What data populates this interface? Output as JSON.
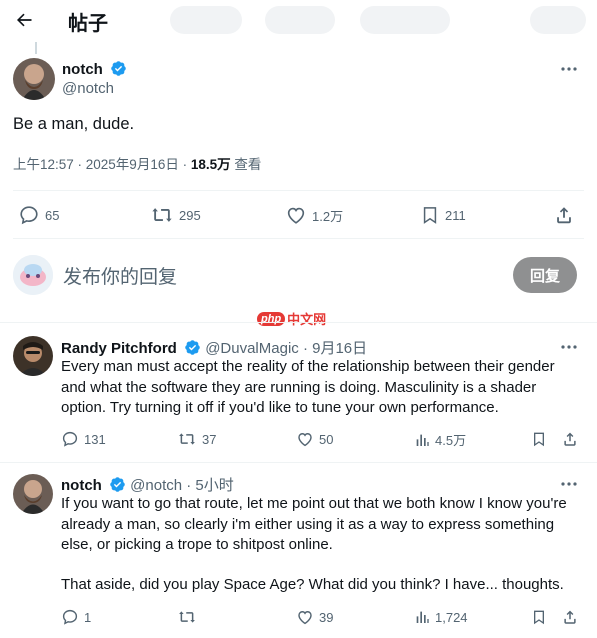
{
  "header": {
    "title": "帖子"
  },
  "post": {
    "author_name": "notch",
    "author_handle": "@notch",
    "text": "Be a man, dude.",
    "time": "上午12:57 · 2025年9月16日 · ",
    "views_count": "18.5万",
    "views_label": " 查看",
    "stats": {
      "replies": "65",
      "reposts": "295",
      "likes": "1.2万",
      "bookmarks": "211"
    }
  },
  "composer": {
    "placeholder": "发布你的回复",
    "button_label": "回复"
  },
  "watermark": {
    "badge": "php",
    "text": "中文网"
  },
  "replies": [
    {
      "name": "Randy Pitchford",
      "handle": "@DuvalMagic",
      "time": "· 9月16日",
      "text": "Every man must accept the reality of the relationship between their gender and what the software they are running is doing. Masculinity is a shader option. Try turning it off if you'd like to tune your own performance.",
      "stats": {
        "replies": "131",
        "reposts": "37",
        "likes": "50",
        "views": "4.5万"
      }
    },
    {
      "name": "notch",
      "handle": "@notch",
      "time": "· 5小时",
      "text_p1": "If you want to go that route, let me point out that we both know I know you're already a man, so clearly i'm either using it as a way to express something else, or picking a trope to shitpost online.",
      "text_p2": "That aside, did you play Space Age? What did you think? I have... thoughts.",
      "stats": {
        "replies": "1",
        "reposts": "",
        "likes": "39",
        "views": "1,724"
      }
    }
  ],
  "colors": {
    "verified": "#1d9bf0",
    "muted": "#536471",
    "text": "#0f1419",
    "reply_button": "#8f9091"
  }
}
